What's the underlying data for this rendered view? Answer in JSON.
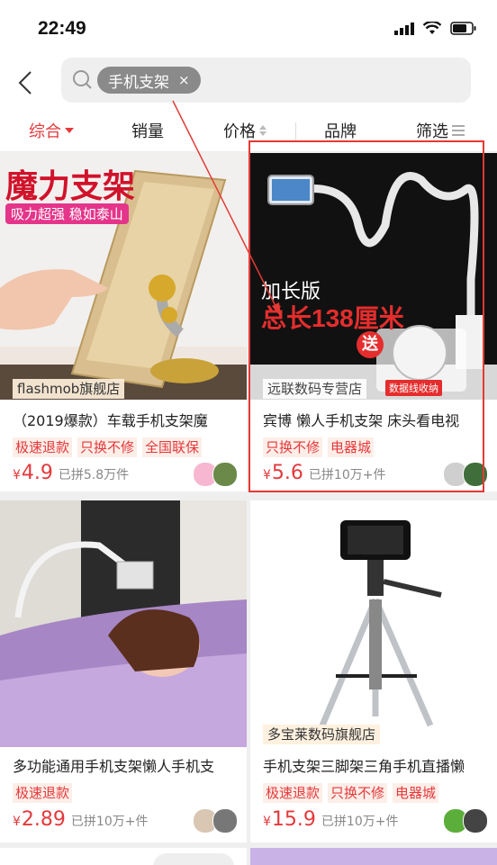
{
  "status": {
    "time": "22:49"
  },
  "search": {
    "query": "手机支架",
    "clear": "×"
  },
  "sort_tabs": {
    "composite": "综合",
    "sales": "销量",
    "price": "价格",
    "brand": "品牌",
    "filter": "筛选"
  },
  "products": [
    {
      "shop": "flashmob旗舰店",
      "title": "（2019爆款）车载手机支架魔",
      "tags": [
        "极速退款",
        "只换不修",
        "全国联保"
      ],
      "currency": "¥",
      "price": "4.9",
      "sold": "已拼5.8万件",
      "img_text": {
        "headline": "魔力支架",
        "banner": "吸力超强 稳如泰山"
      }
    },
    {
      "shop": "远联数码专营店",
      "title": "宾博 懒人手机支架 床头看电视",
      "tags": [
        "只换不修",
        "电器城"
      ],
      "currency": "¥",
      "price": "5.6",
      "sold": "已拼10万+件",
      "img_text": {
        "line1": "加长版",
        "line2": "总长138厘米",
        "gift": "送",
        "cable": "数据线收纳"
      }
    },
    {
      "shop": "",
      "title": "多功能通用手机支架懒人手机支",
      "tags": [
        "极速退款"
      ],
      "currency": "¥",
      "price": "2.89",
      "sold": "已拼10万+件"
    },
    {
      "shop": "多宝莱数码旗舰店",
      "title": "手机支架三脚架三角手机直播懒",
      "tags": [
        "极速退款",
        "只换不修",
        "电器城"
      ],
      "currency": "¥",
      "price": "15.9",
      "sold": "已拼10万+件"
    }
  ],
  "colors": {
    "accent": "#e4393c",
    "highlight": "#e53935"
  }
}
